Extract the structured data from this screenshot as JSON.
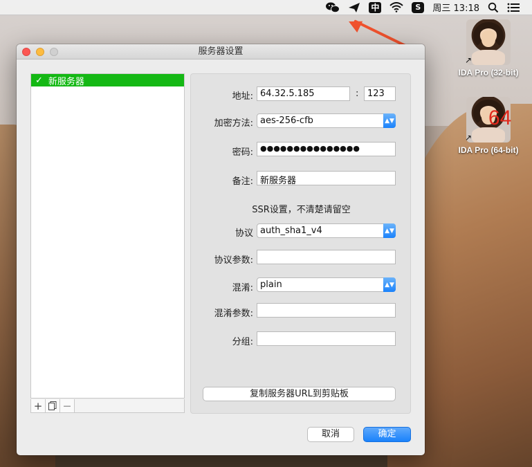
{
  "menubar": {
    "ime_label": "中",
    "sogou_label": "S",
    "clock": "周三 13:18"
  },
  "desktop": {
    "icons": [
      {
        "label": "IDA Pro (32-bit)",
        "badge": ""
      },
      {
        "label": "IDA Pro (64-bit)",
        "badge": "64"
      }
    ]
  },
  "window": {
    "title": "服务器设置",
    "server_list": [
      {
        "name": "新服务器",
        "selected": true
      }
    ],
    "list_tools": {
      "add": "+",
      "remove": "—"
    },
    "form": {
      "address_label": "地址:",
      "address_value": "64.32.5.185",
      "port_separator": ":",
      "port_value": "123",
      "encryption_label": "加密方法:",
      "encryption_value": "aes-256-cfb",
      "password_label": "密码:",
      "password_value": "●●●●●●●●●●●●●●●",
      "remark_label": "备注:",
      "remark_value": "新服务器",
      "ssr_note": "SSR设置，不清楚请留空",
      "protocol_label": "协议",
      "protocol_value": "auth_sha1_v4",
      "protocol_param_label": "协议参数:",
      "protocol_param_value": "",
      "obfs_label": "混淆:",
      "obfs_value": "plain",
      "obfs_param_label": "混淆参数:",
      "obfs_param_value": "",
      "group_label": "分组:",
      "group_value": "",
      "copy_url_button": "复制服务器URL到剪贴板"
    },
    "cancel_button": "取消",
    "ok_button": "确定"
  },
  "colors": {
    "selection_green": "#14b814",
    "accent_blue": "#1a82fb",
    "annotation_arrow": "#f0522e"
  }
}
